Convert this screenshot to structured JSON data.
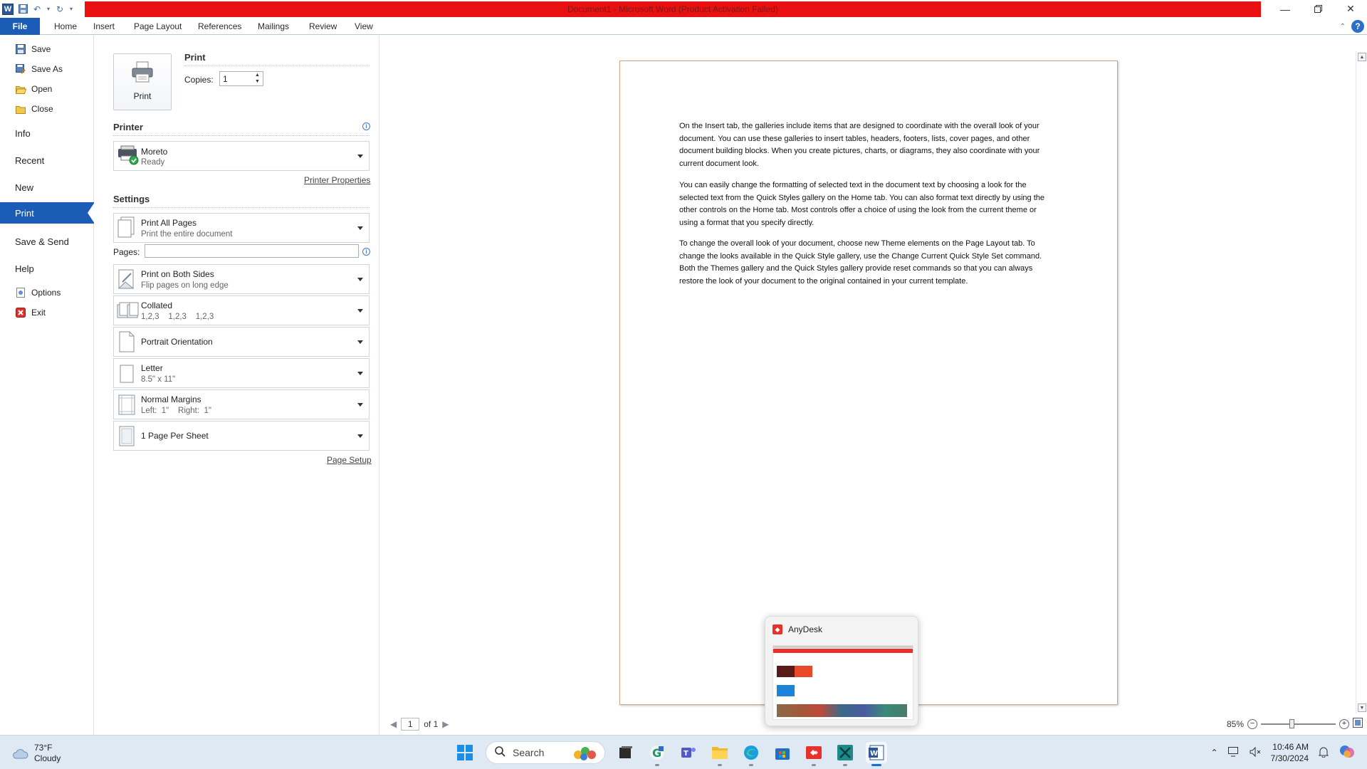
{
  "titlebar": {
    "title": "Document1  -  Microsoft Word (Product Activation Failed)",
    "word_logo": "W"
  },
  "ribbon": {
    "file_tab": "File",
    "tabs": [
      "Home",
      "Insert",
      "Page Layout",
      "References",
      "Mailings",
      "Review",
      "View"
    ],
    "help": "?"
  },
  "nav": {
    "save": "Save",
    "save_as": "Save As",
    "open": "Open",
    "close": "Close",
    "info": "Info",
    "recent": "Recent",
    "new": "New",
    "print": "Print",
    "save_send": "Save & Send",
    "help": "Help",
    "options": "Options",
    "exit": "Exit"
  },
  "print_panel": {
    "button_label": "Print",
    "section_title": "Print",
    "copies_label": "Copies:",
    "copies_value": "1",
    "printer_title": "Printer",
    "printer_name": "Moreto",
    "printer_status": "Ready",
    "printer_properties": "Printer Properties",
    "settings_title": "Settings",
    "pages_label": "Pages:",
    "pages_value": "",
    "page_setup": "Page Setup",
    "settings": {
      "range": {
        "t1": "Print All Pages",
        "t2": "Print the entire document"
      },
      "sides": {
        "t1": "Print on Both Sides",
        "t2": "Flip pages on long edge"
      },
      "collate": {
        "t1": "Collated",
        "t2": "1,2,3    1,2,3    1,2,3"
      },
      "orientation": {
        "t1": "Portrait Orientation"
      },
      "paper": {
        "t1": "Letter",
        "t2": "8.5\" x 11\""
      },
      "margins": {
        "t1": "Normal Margins",
        "t2": "Left:  1\"    Right:  1\""
      },
      "sheets": {
        "t1": "1 Page Per Sheet"
      }
    }
  },
  "preview": {
    "paragraphs": [
      "On the Insert tab, the galleries include items that are designed to coordinate with the overall look of your document. You can use these galleries to insert tables, headers, footers, lists, cover pages, and other document building blocks. When you create pictures, charts, or diagrams, they also coordinate with your current document look.",
      "You can easily change the formatting of selected text in the document text by choosing a look for the selected text from the Quick Styles gallery on the Home tab. You can also format text directly by using the other controls on the Home tab. Most controls offer a choice of using the look from the current theme or using a format that you specify directly.",
      "To change the overall look of your document, choose new Theme elements on the Page Layout tab. To change the looks available in the Quick Style gallery, use the Change Current Quick Style Set command. Both the Themes gallery and the Quick Styles gallery provide reset commands so that you can always restore the look of your document to the original contained in your current template."
    ],
    "current_page": "1",
    "of_pages": "of 1",
    "zoom": "85%",
    "zoom_level_percent": 85
  },
  "popup": {
    "app_name": "AnyDesk"
  },
  "taskbar": {
    "temperature": "73°F",
    "condition": "Cloudy",
    "search_placeholder": "Search",
    "time": "10:46 AM",
    "date": "7/30/2024"
  },
  "colors": {
    "title_bar_red": "#e81010",
    "file_tab_blue": "#1b5cb6",
    "taskbar_bg": "#dfe9f3"
  }
}
